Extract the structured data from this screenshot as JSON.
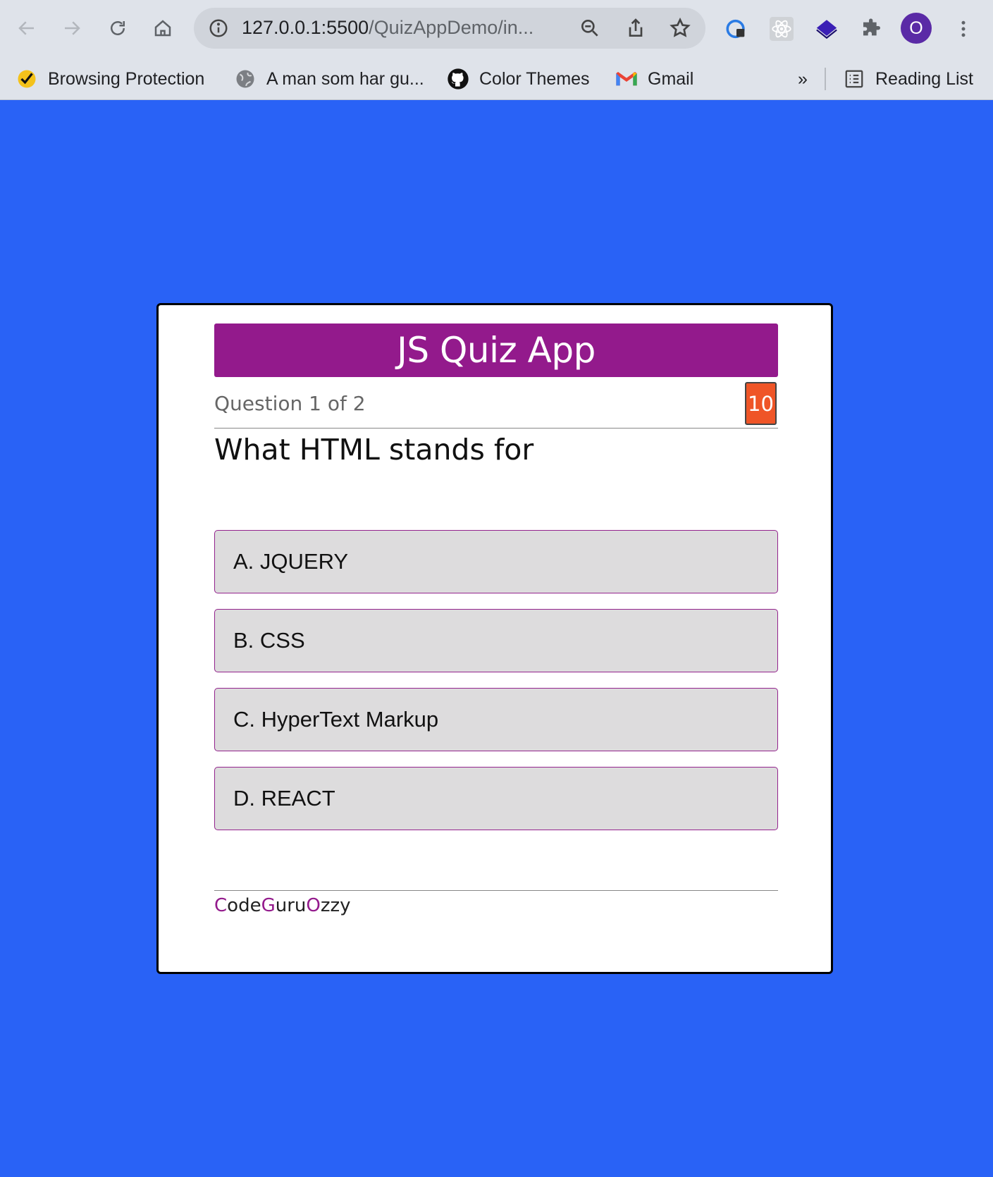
{
  "browser": {
    "url_host": "127.0.0.1:5500",
    "url_path": "/QuizAppDemo/in...",
    "profile_initial": "O",
    "bookmarks": [
      {
        "label": "Browsing Protection",
        "icon": "norton-check-icon"
      },
      {
        "label": "A man som har gu...",
        "icon": "globe-icon"
      },
      {
        "label": "Color Themes",
        "icon": "github-icon"
      },
      {
        "label": "Gmail",
        "icon": "gmail-icon"
      }
    ],
    "overflow_label": "»",
    "reading_list_label": "Reading List"
  },
  "quiz": {
    "title": "JS Quiz App",
    "progress": "Question 1 of 2",
    "timer": "10",
    "question": "What HTML stands for",
    "options": [
      "A. JQUERY",
      "B. CSS",
      "C. HyperText Markup",
      "D. REACT"
    ],
    "footer": {
      "c": "C",
      "ode": "ode",
      "g": "G",
      "uru": "uru",
      "o": "O",
      "zzy": "zzy"
    }
  },
  "colors": {
    "page_background": "#2962f6",
    "header_bar": "#931a8c",
    "timer_badge": "#ef5527",
    "option_background": "#dddcdd",
    "option_border": "#93238d"
  }
}
